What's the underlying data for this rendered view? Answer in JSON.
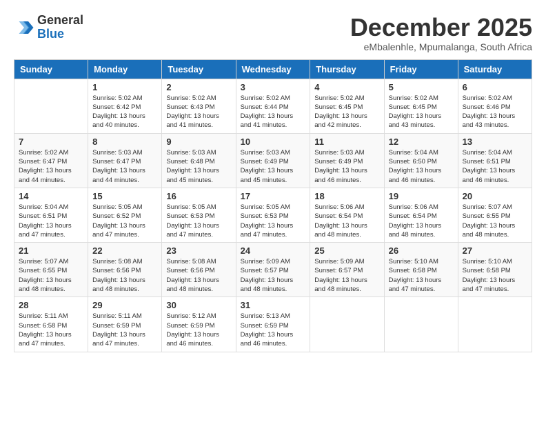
{
  "header": {
    "logo_line1": "General",
    "logo_line2": "Blue",
    "month": "December 2025",
    "location": "eMbalenhle, Mpumalanga, South Africa"
  },
  "days_of_week": [
    "Sunday",
    "Monday",
    "Tuesday",
    "Wednesday",
    "Thursday",
    "Friday",
    "Saturday"
  ],
  "weeks": [
    [
      {
        "day": "",
        "sunrise": "",
        "sunset": "",
        "daylight": ""
      },
      {
        "day": "1",
        "sunrise": "Sunrise: 5:02 AM",
        "sunset": "Sunset: 6:42 PM",
        "daylight": "Daylight: 13 hours and 40 minutes."
      },
      {
        "day": "2",
        "sunrise": "Sunrise: 5:02 AM",
        "sunset": "Sunset: 6:43 PM",
        "daylight": "Daylight: 13 hours and 41 minutes."
      },
      {
        "day": "3",
        "sunrise": "Sunrise: 5:02 AM",
        "sunset": "Sunset: 6:44 PM",
        "daylight": "Daylight: 13 hours and 41 minutes."
      },
      {
        "day": "4",
        "sunrise": "Sunrise: 5:02 AM",
        "sunset": "Sunset: 6:45 PM",
        "daylight": "Daylight: 13 hours and 42 minutes."
      },
      {
        "day": "5",
        "sunrise": "Sunrise: 5:02 AM",
        "sunset": "Sunset: 6:45 PM",
        "daylight": "Daylight: 13 hours and 43 minutes."
      },
      {
        "day": "6",
        "sunrise": "Sunrise: 5:02 AM",
        "sunset": "Sunset: 6:46 PM",
        "daylight": "Daylight: 13 hours and 43 minutes."
      }
    ],
    [
      {
        "day": "7",
        "sunrise": "Sunrise: 5:02 AM",
        "sunset": "Sunset: 6:47 PM",
        "daylight": "Daylight: 13 hours and 44 minutes."
      },
      {
        "day": "8",
        "sunrise": "Sunrise: 5:03 AM",
        "sunset": "Sunset: 6:47 PM",
        "daylight": "Daylight: 13 hours and 44 minutes."
      },
      {
        "day": "9",
        "sunrise": "Sunrise: 5:03 AM",
        "sunset": "Sunset: 6:48 PM",
        "daylight": "Daylight: 13 hours and 45 minutes."
      },
      {
        "day": "10",
        "sunrise": "Sunrise: 5:03 AM",
        "sunset": "Sunset: 6:49 PM",
        "daylight": "Daylight: 13 hours and 45 minutes."
      },
      {
        "day": "11",
        "sunrise": "Sunrise: 5:03 AM",
        "sunset": "Sunset: 6:49 PM",
        "daylight": "Daylight: 13 hours and 46 minutes."
      },
      {
        "day": "12",
        "sunrise": "Sunrise: 5:04 AM",
        "sunset": "Sunset: 6:50 PM",
        "daylight": "Daylight: 13 hours and 46 minutes."
      },
      {
        "day": "13",
        "sunrise": "Sunrise: 5:04 AM",
        "sunset": "Sunset: 6:51 PM",
        "daylight": "Daylight: 13 hours and 46 minutes."
      }
    ],
    [
      {
        "day": "14",
        "sunrise": "Sunrise: 5:04 AM",
        "sunset": "Sunset: 6:51 PM",
        "daylight": "Daylight: 13 hours and 47 minutes."
      },
      {
        "day": "15",
        "sunrise": "Sunrise: 5:05 AM",
        "sunset": "Sunset: 6:52 PM",
        "daylight": "Daylight: 13 hours and 47 minutes."
      },
      {
        "day": "16",
        "sunrise": "Sunrise: 5:05 AM",
        "sunset": "Sunset: 6:53 PM",
        "daylight": "Daylight: 13 hours and 47 minutes."
      },
      {
        "day": "17",
        "sunrise": "Sunrise: 5:05 AM",
        "sunset": "Sunset: 6:53 PM",
        "daylight": "Daylight: 13 hours and 47 minutes."
      },
      {
        "day": "18",
        "sunrise": "Sunrise: 5:06 AM",
        "sunset": "Sunset: 6:54 PM",
        "daylight": "Daylight: 13 hours and 48 minutes."
      },
      {
        "day": "19",
        "sunrise": "Sunrise: 5:06 AM",
        "sunset": "Sunset: 6:54 PM",
        "daylight": "Daylight: 13 hours and 48 minutes."
      },
      {
        "day": "20",
        "sunrise": "Sunrise: 5:07 AM",
        "sunset": "Sunset: 6:55 PM",
        "daylight": "Daylight: 13 hours and 48 minutes."
      }
    ],
    [
      {
        "day": "21",
        "sunrise": "Sunrise: 5:07 AM",
        "sunset": "Sunset: 6:55 PM",
        "daylight": "Daylight: 13 hours and 48 minutes."
      },
      {
        "day": "22",
        "sunrise": "Sunrise: 5:08 AM",
        "sunset": "Sunset: 6:56 PM",
        "daylight": "Daylight: 13 hours and 48 minutes."
      },
      {
        "day": "23",
        "sunrise": "Sunrise: 5:08 AM",
        "sunset": "Sunset: 6:56 PM",
        "daylight": "Daylight: 13 hours and 48 minutes."
      },
      {
        "day": "24",
        "sunrise": "Sunrise: 5:09 AM",
        "sunset": "Sunset: 6:57 PM",
        "daylight": "Daylight: 13 hours and 48 minutes."
      },
      {
        "day": "25",
        "sunrise": "Sunrise: 5:09 AM",
        "sunset": "Sunset: 6:57 PM",
        "daylight": "Daylight: 13 hours and 48 minutes."
      },
      {
        "day": "26",
        "sunrise": "Sunrise: 5:10 AM",
        "sunset": "Sunset: 6:58 PM",
        "daylight": "Daylight: 13 hours and 47 minutes."
      },
      {
        "day": "27",
        "sunrise": "Sunrise: 5:10 AM",
        "sunset": "Sunset: 6:58 PM",
        "daylight": "Daylight: 13 hours and 47 minutes."
      }
    ],
    [
      {
        "day": "28",
        "sunrise": "Sunrise: 5:11 AM",
        "sunset": "Sunset: 6:58 PM",
        "daylight": "Daylight: 13 hours and 47 minutes."
      },
      {
        "day": "29",
        "sunrise": "Sunrise: 5:11 AM",
        "sunset": "Sunset: 6:59 PM",
        "daylight": "Daylight: 13 hours and 47 minutes."
      },
      {
        "day": "30",
        "sunrise": "Sunrise: 5:12 AM",
        "sunset": "Sunset: 6:59 PM",
        "daylight": "Daylight: 13 hours and 46 minutes."
      },
      {
        "day": "31",
        "sunrise": "Sunrise: 5:13 AM",
        "sunset": "Sunset: 6:59 PM",
        "daylight": "Daylight: 13 hours and 46 minutes."
      },
      {
        "day": "",
        "sunrise": "",
        "sunset": "",
        "daylight": ""
      },
      {
        "day": "",
        "sunrise": "",
        "sunset": "",
        "daylight": ""
      },
      {
        "day": "",
        "sunrise": "",
        "sunset": "",
        "daylight": ""
      }
    ]
  ]
}
